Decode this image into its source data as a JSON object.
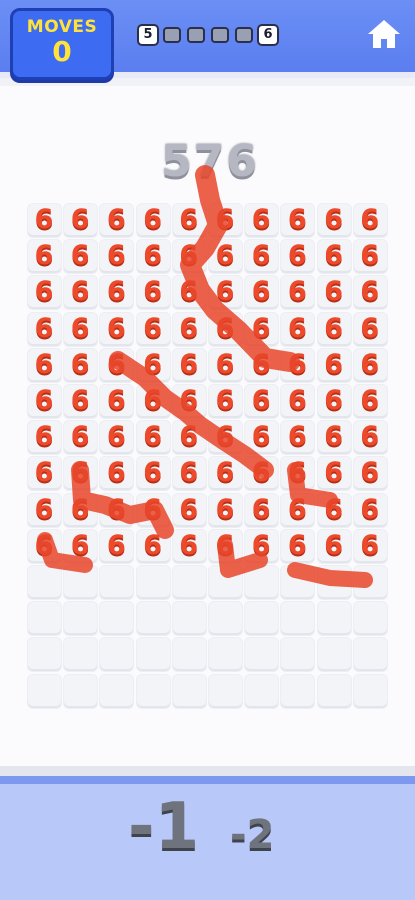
{
  "header": {
    "moves_label": "MOVES",
    "moves_value": "0",
    "level_start": "5",
    "level_end": "6",
    "progress_pips": 3,
    "home_icon": "home-icon"
  },
  "board": {
    "target_number": "576",
    "tile_value": "6",
    "columns": 10,
    "rows": 14,
    "filled_rows": 10
  },
  "operators": {
    "primary": "-1",
    "secondary": "-2"
  },
  "colors": {
    "tile": "#ec4a2a",
    "header": "#5b7ef0",
    "moves_text": "#ffe33a"
  }
}
